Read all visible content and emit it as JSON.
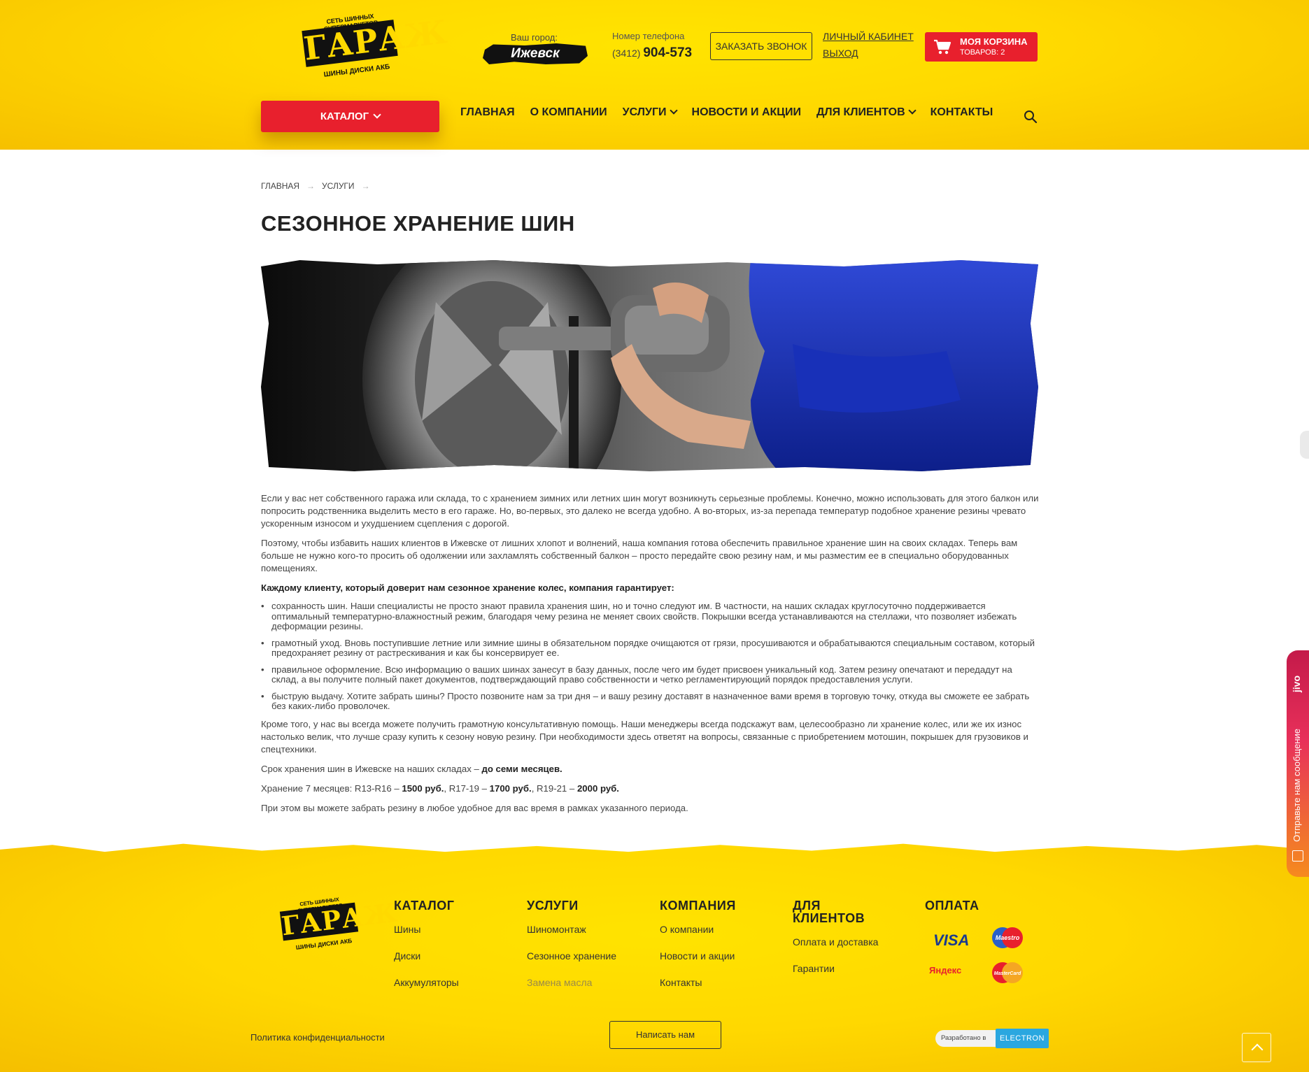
{
  "header": {
    "logo": {
      "top": "СЕТЬ ШИННЫХ СУПЕРМАРКЕТОВ",
      "main": "ГАРАЖ",
      "bottom": "ШИНЫ ДИСКИ АКБ"
    },
    "city": {
      "label": "Ваш город:",
      "name": "Ижевск"
    },
    "phone": {
      "label": "Номер телефона",
      "code": "(3412)",
      "number": "904-573"
    },
    "callback_label": "ЗАКАЗАТЬ ЗВОНОК",
    "cabinet_label": "ЛИЧНЫЙ КАБИНЕТ",
    "logout_label": "ВЫХОД",
    "cart": {
      "title": "МОЯ КОРЗИНА",
      "count": "ТОВАРОВ: 2",
      "icon": "cart-icon"
    },
    "catalog_label": "КАТАЛОГ",
    "nav": [
      {
        "label": "ГЛАВНАЯ",
        "dropdown": false
      },
      {
        "label": "О КОМПАНИИ",
        "dropdown": false
      },
      {
        "label": "УСЛУГИ",
        "dropdown": true
      },
      {
        "label": "НОВОСТИ И АКЦИИ",
        "dropdown": false
      },
      {
        "label": "ДЛЯ КЛИЕНТОВ",
        "dropdown": true
      },
      {
        "label": "КОНТАКТЫ",
        "dropdown": false
      }
    ]
  },
  "breadcrumb": [
    "ГЛАВНАЯ",
    "УСЛУГИ"
  ],
  "page": {
    "title": "СЕЗОННОЕ ХРАНЕНИЕ ШИН",
    "p1": "Если у вас нет собственного гаража или склада, то с хранением зимних или летних шин могут возникнуть серьезные проблемы. Конечно, можно использовать для этого балкон или попросить родственника выделить место в его гараже. Но, во-первых, это далеко не всегда удобно. А во-вторых, из-за перепада температур подобное хранение резины чревато ускоренным износом и ухудшением сцепления с дорогой.",
    "p2": "Поэтому, чтобы избавить наших клиентов в Ижевске от лишних хлопот и волнений, наша компания готова обеспечить правильное хранение шин на своих складах. Теперь вам больше не нужно кого-то просить об одолжении или захламлять собственный балкон – просто передайте свою резину нам, и мы разместим ее в специально оборудованных помещениях.",
    "guarantee_heading": "Каждому клиенту, который доверит нам сезонное хранение колес, компания гарантирует:",
    "list": [
      "сохранность шин. Наши специалисты не просто знают правила хранения шин, но и точно следуют им. В частности, на наших складах круглосуточно поддерживается оптимальный температурно-влажностный режим, благодаря чему резина не меняет своих свойств. Покрышки всегда устанавливаются на стеллажи, что позволяет избежать деформации резины.",
      "грамотный уход. Вновь поступившие летние или зимние шины в обязательном порядке очищаются от грязи, просушиваются и обрабатываются специальным составом, который предохраняет резину от растрескивания и как бы консервирует ее.",
      "правильное оформление. Всю информацию о ваших шинах занесут в базу данных, после чего им будет присвоен уникальный код. Затем резину опечатают и передадут на склад, а вы получите полный пакет документов, подтверждающий право собственности и четко регламентирующий порядок предоставления услуги.",
      "быструю выдачу. Хотите забрать шины? Просто позвоните нам за три дня – и вашу резину доставят в назначенное вами время в торговую точку, откуда вы сможете ее забрать без каких-либо проволочек."
    ],
    "p3": "Кроме того, у нас вы всегда можете получить грамотную консультативную помощь. Наши менеджеры всегда подскажут вам, целесообразно ли хранение колес, или же их износ настолько велик, что лучше сразу купить к сезону новую резину. При необходимости здесь ответят на вопросы, связанные с приобретением мотошин, покрышек для грузовиков и спецтехники.",
    "term_text": "Срок хранения шин в Ижевске на наших складах – ",
    "term_bold": "до семи месяцев.",
    "price_prefix": "Хранение 7 месяцев: R13-R16 – ",
    "price1": "1500 руб.",
    "price_mid1": ", R17-19 – ",
    "price2": "1700 руб.",
    "price_mid2": ", R19-21 – ",
    "price3": "2000 руб.",
    "p_last": "При этом вы можете забрать резину в любое удобное для вас время в рамках указанного периода."
  },
  "footer": {
    "columns": [
      {
        "title": "КАТАЛОГ",
        "links": [
          {
            "label": "Шины",
            "active": false
          },
          {
            "label": "Диски",
            "active": false
          },
          {
            "label": "Аккумуляторы",
            "active": false
          }
        ]
      },
      {
        "title": "УСЛУГИ",
        "links": [
          {
            "label": "Шиномонтаж",
            "active": false
          },
          {
            "label": "Сезонное хранение",
            "active": false
          },
          {
            "label": "Замена масла",
            "active": true
          }
        ]
      },
      {
        "title": "КОМПАНИЯ",
        "links": [
          {
            "label": "О компании",
            "active": false
          },
          {
            "label": "Новости и акции",
            "active": false
          },
          {
            "label": "Контакты",
            "active": false
          }
        ]
      },
      {
        "title_line1": "ДЛЯ",
        "title_line2": "КЛИЕНТОВ",
        "links": [
          {
            "label": "Оплата и доставка",
            "active": false
          },
          {
            "label": "Гарантии",
            "active": false
          }
        ]
      }
    ],
    "payment": {
      "title": "ОПЛАТА",
      "visa": "VISA",
      "maestro": "Maestro",
      "yandex": "Яндекс",
      "mastercard": "MasterCard"
    },
    "privacy_label": "Политика конфиденциальности",
    "write_label": "Написать нам",
    "dev": {
      "text": "Разработано в",
      "brand": "ELECTRON"
    }
  },
  "jivo": {
    "brand": "jivo",
    "text": "Отправьте нам сообщение"
  },
  "colors": {
    "accent_red": "#e8202d",
    "brand_yellow": "#ffd900",
    "jivo_gradient": "#e8305a"
  }
}
